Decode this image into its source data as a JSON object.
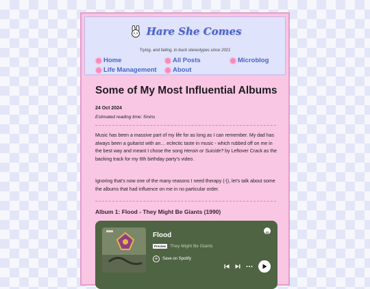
{
  "site": {
    "title": "Hare She Comes",
    "tagline": "Trying, and failing, to buck stereotypes since 2021"
  },
  "nav": {
    "items": [
      {
        "label": "Home"
      },
      {
        "label": "All Posts"
      },
      {
        "label": "Microblog"
      },
      {
        "label": "Life Management"
      },
      {
        "label": "About"
      }
    ]
  },
  "post": {
    "title": "Some of My Most Influential Albums",
    "date": "24 Oct 2024",
    "reading_time": "Estimated reading time: 5mins",
    "para1_a": "Music has been a massive part of my life for as long as I can remember. My dad has always been a guitarist with an… eclectic taste in music - which rubbed off on me in the best way and meant I chose the song ",
    "para1_song": "Heroin or Suicide?",
    "para1_b": " by Leftover Crack as the backing track for my 6th birthday party’s video.",
    "para2": "Ignoring that’s now one of the many reasons I need therapy (-|), let’s talk about some the albums that had influence on me in no particular order.",
    "album1_heading": "Album 1: Flood - They Might Be Giants (1990)"
  },
  "player": {
    "album": "Flood",
    "badge": "Preview",
    "artist": "They Might Be Giants",
    "save_label": "Save on Spotify"
  },
  "colors": {
    "page_bg": "#f6f7fd",
    "frame_pink": "#f9c6e4",
    "header_blue": "#dfe3fb",
    "link_blue": "#4a63c9",
    "player_green": "#4f6442"
  }
}
